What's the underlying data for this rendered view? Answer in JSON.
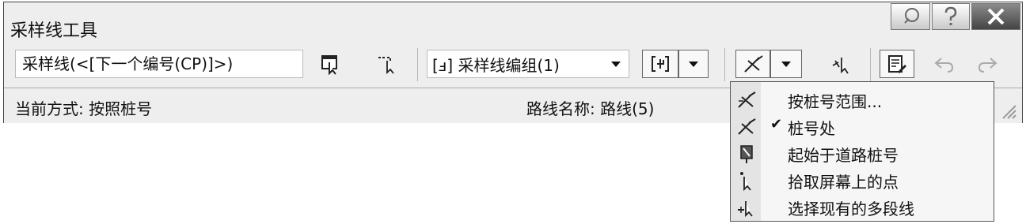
{
  "window": {
    "title": "采样线工具"
  },
  "toolbar": {
    "sample_line_field": "采样线(<[下一个编号(CP)]>)",
    "group_combo": "[ⅎ] 采样线编组(1)"
  },
  "status": {
    "mode": "当前方式: 按照桩号",
    "alignment": "路线名称: 路线(5)"
  },
  "menu": {
    "items": [
      {
        "label": "按桩号范围...",
        "checked": false,
        "icon": "station-range-icon"
      },
      {
        "label": "桩号处",
        "checked": true,
        "icon": "at-station-icon"
      },
      {
        "label": "起始于道路桩号",
        "checked": false,
        "icon": "from-corridor-station-icon"
      },
      {
        "label": "拾取屏幕上的点",
        "checked": false,
        "icon": "pick-points-icon"
      },
      {
        "label": "选择现有的多段线",
        "checked": false,
        "icon": "select-polyline-icon"
      }
    ],
    "check_mark": "✔"
  }
}
